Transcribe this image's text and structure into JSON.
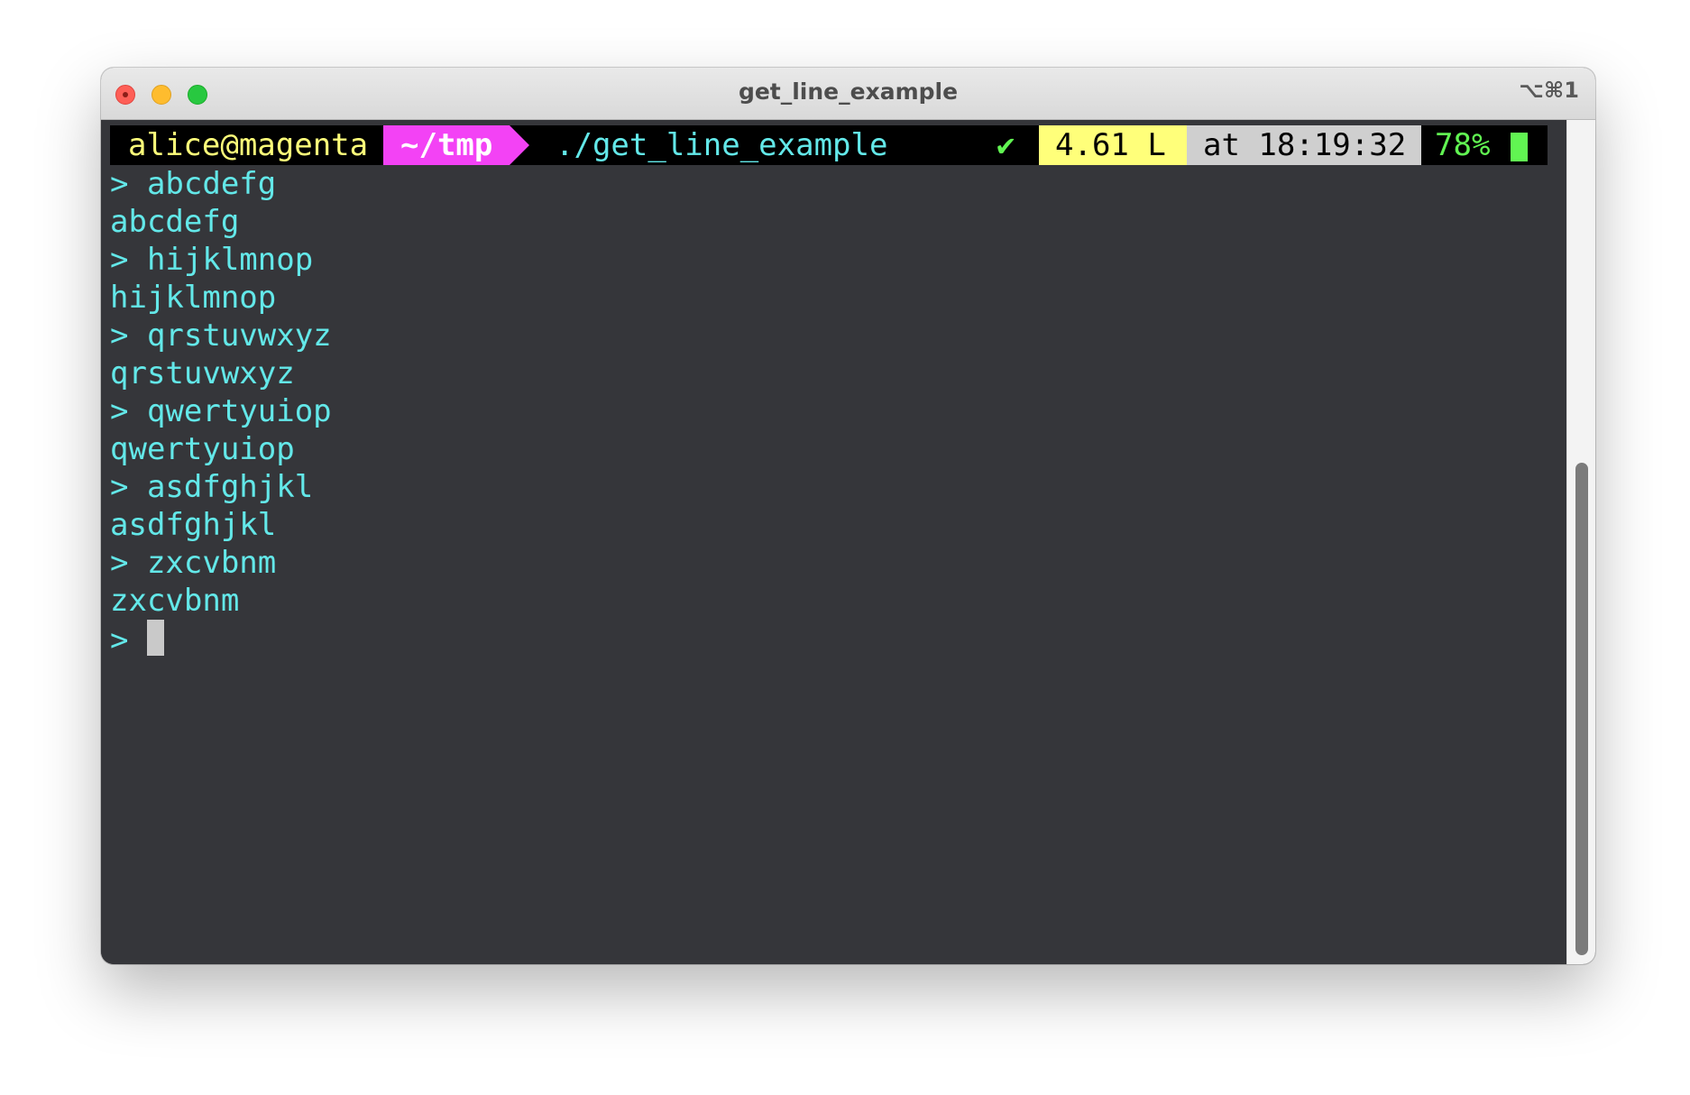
{
  "window": {
    "title": "get_line_example",
    "shortcut": "⌥⌘1"
  },
  "prompt": {
    "user_host": "alice@magenta",
    "directory": "~/tmp",
    "command": "./get_line_example",
    "status_icon": "✔",
    "load": "4.61 L",
    "time": "at 18:19:32",
    "battery": "78%"
  },
  "terminal": {
    "caret": ">",
    "lines": [
      {
        "prefix": "> ",
        "text": "abcdefg"
      },
      {
        "prefix": "",
        "text": "abcdefg"
      },
      {
        "prefix": "> ",
        "text": "hijklmnop"
      },
      {
        "prefix": "",
        "text": "hijklmnop"
      },
      {
        "prefix": "> ",
        "text": "qrstuvwxyz"
      },
      {
        "prefix": "",
        "text": "qrstuvwxyz"
      },
      {
        "prefix": "> ",
        "text": "qwertyuiop"
      },
      {
        "prefix": "",
        "text": "qwertyuiop"
      },
      {
        "prefix": "> ",
        "text": "asdfghjkl"
      },
      {
        "prefix": "",
        "text": "asdfghjkl"
      },
      {
        "prefix": "> ",
        "text": "zxcvbnm"
      },
      {
        "prefix": "",
        "text": "zxcvbnm"
      }
    ],
    "input_prompt": "> "
  },
  "colors": {
    "terminal_bg": "#35363a",
    "text": "#63e8e9",
    "user": "#ffff7a",
    "dir_bg": "#f342f5",
    "ok": "#61f552",
    "load_bg": "#ffff7a",
    "time_bg": "#cfcfcf"
  }
}
